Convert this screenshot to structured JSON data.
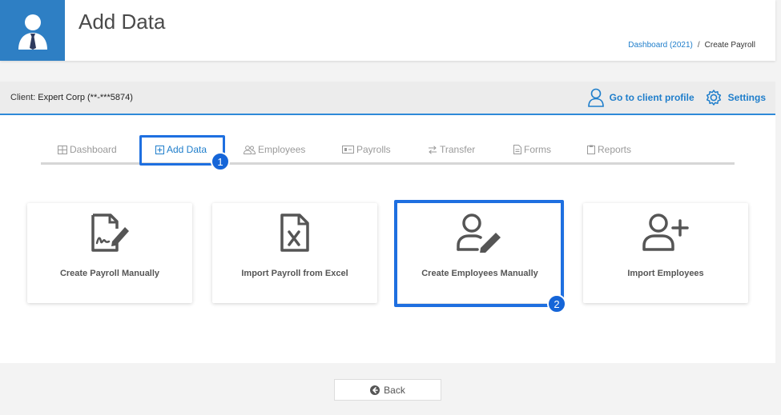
{
  "header": {
    "title": "Add Data",
    "avatar_icon": "user-tie-icon",
    "breadcrumb": {
      "link": "Dashboard (2021)",
      "separator": "/",
      "current": "Create Payroll"
    }
  },
  "client_bar": {
    "label": "Client:",
    "client_name": "Expert Corp (**-***5874)",
    "profile_link": "Go to client profile",
    "settings_link": "Settings"
  },
  "tabs": [
    {
      "label": "Dashboard",
      "icon": "grid-icon",
      "active": false
    },
    {
      "label": "Add Data",
      "icon": "plus-square-icon",
      "active": true
    },
    {
      "label": "Employees",
      "icon": "users-icon",
      "active": false
    },
    {
      "label": "Payrolls",
      "icon": "money-icon",
      "active": false
    },
    {
      "label": "Transfer",
      "icon": "transfer-icon",
      "active": false
    },
    {
      "label": "Forms",
      "icon": "file-icon",
      "active": false
    },
    {
      "label": "Reports",
      "icon": "clipboard-icon",
      "active": false
    }
  ],
  "cards": [
    {
      "label": "Create Payroll Manually",
      "icon": "file-signature-icon"
    },
    {
      "label": "Import Payroll from Excel",
      "icon": "file-excel-icon"
    },
    {
      "label": "Create Employees Manually",
      "icon": "user-edit-icon"
    },
    {
      "label": "Import Employees",
      "icon": "user-plus-icon"
    }
  ],
  "callouts": {
    "one": "1",
    "two": "2"
  },
  "footer": {
    "back_label": "Back"
  },
  "colors": {
    "accent": "#1f7ecb",
    "highlight": "#1e6fe0",
    "avatar_bg": "#2e7fc4"
  }
}
